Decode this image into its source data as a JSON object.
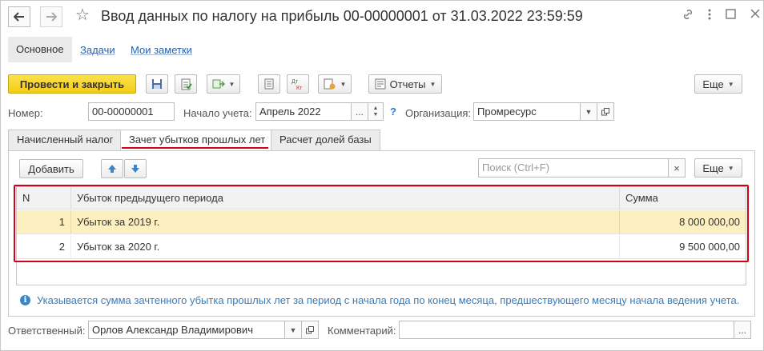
{
  "window": {
    "title": "Ввод данных по налогу на прибыль 00-00000001 от 31.03.2022 23:59:59",
    "nav_back_icon": "arrow-left-icon",
    "nav_forward_icon": "arrow-right-icon",
    "star_icon": "star-icon",
    "link_icon": "link-icon",
    "more_icon": "more-vertical-icon",
    "maximize_icon": "square-icon",
    "close_icon": "close-icon"
  },
  "sections": {
    "active": "Основное",
    "links": [
      "Задачи",
      "Мои заметки"
    ]
  },
  "toolbar": {
    "post_close": "Провести и закрыть",
    "reports": "Отчеты",
    "more": "Еще"
  },
  "header": {
    "number_label": "Номер:",
    "number_value": "00-00000001",
    "start_label": "Начало учета:",
    "start_value": "Апрель 2022",
    "start_ellipsis": "...",
    "help": "?",
    "org_label": "Организация:",
    "org_value": "Промресурс"
  },
  "tabs": [
    "Начисленный налог",
    "Зачет убытков прошлых лет",
    "Расчет долей базы"
  ],
  "active_tab": 1,
  "table_toolbar": {
    "add": "Добавить",
    "search_placeholder": "Поиск (Ctrl+F)",
    "clear": "×",
    "more": "Еще"
  },
  "table": {
    "columns": [
      "N",
      "Убыток предыдущего периода",
      "Сумма"
    ],
    "rows": [
      {
        "n": "1",
        "name": "Убыток за 2019 г.",
        "sum": "8 000 000,00"
      },
      {
        "n": "2",
        "name": "Убыток за 2020 г.",
        "sum": "9 500 000,00"
      }
    ]
  },
  "info": {
    "icon": "i",
    "text": "Указывается сумма зачтенного убытка прошлых лет за период с начала года по конец месяца, предшествующего месяцу начала ведения учета."
  },
  "footer": {
    "responsible_label": "Ответственный:",
    "responsible_value": "Орлов Александр Владимирович",
    "comment_label": "Комментарий:",
    "comment_value": "",
    "ellipsis": "..."
  },
  "colors": {
    "primary_button": "#f2cc17",
    "highlight": "#d0021b",
    "selected_row": "#fdf0c0",
    "link": "#2a5ea9"
  }
}
